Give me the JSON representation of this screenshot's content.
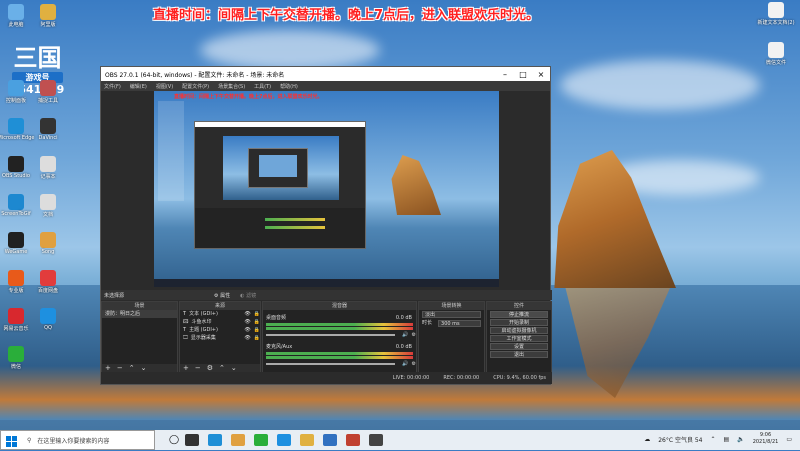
{
  "banner": "直播时间：间隔上下午交替开播。晚上7点后，进入联盟欢乐时光。",
  "logo": {
    "top": "三国",
    "mid": "游戏号",
    "num": "9541939"
  },
  "desktop_left": [
    {
      "label": "此电脑",
      "color": "#6ab0e8"
    },
    {
      "label": "阿里版",
      "color": "#e0b040"
    },
    {
      "label": "控制面板",
      "color": "#4aa0e0"
    },
    {
      "label": "捕捉工具",
      "color": "#c05050"
    },
    {
      "label": "Microsoft Edge",
      "color": "#1f8fd6"
    },
    {
      "label": "DaVinci",
      "color": "#333333"
    },
    {
      "label": "OBS Studio",
      "color": "#222222"
    },
    {
      "label": "记事本",
      "color": "#dddddd"
    },
    {
      "label": "ScreenToGif",
      "color": "#1d88d0"
    },
    {
      "label": "文档",
      "color": "#dddddd"
    },
    {
      "label": "WeGame",
      "color": "#202020"
    },
    {
      "label": "Song",
      "color": "#e0a040"
    },
    {
      "label": "专业版",
      "color": "#e85a1a"
    },
    {
      "label": "百度网盘",
      "color": "#e23c3c"
    },
    {
      "label": "网易云音乐",
      "color": "#d8282e"
    },
    {
      "label": "QQ",
      "color": "#1e90e0"
    },
    {
      "label": "微信",
      "color": "#2aae3a"
    }
  ],
  "desktop_right": [
    {
      "label": "新建文本文档(2)",
      "color": "#f2f2f2"
    },
    {
      "label": "微信文件",
      "color": "#f2f2f2"
    }
  ],
  "obs": {
    "title": "OBS 27.0.1 (64-bit, windows) - 配置文件: 未命名 - 场景: 未命名",
    "menu": [
      "文件(F)",
      "编辑(E)",
      "视图(V)",
      "配置文件(P)",
      "场景集合(S)",
      "工具(T)",
      "帮助(H)"
    ],
    "preview_banner": "直播时间：间隔上下午交替开播。晚上7点后，进入联盟欢乐时光。",
    "scene_label": "未选择源",
    "props_btn": "属性",
    "filters_btn": "滤镜",
    "panels": {
      "scenes": {
        "title": "场景",
        "items": [
          "漫防：明日之后"
        ]
      },
      "sources": {
        "title": "来源",
        "items": [
          "文本 (GDI+)",
          "斗鱼水印",
          "主题 (GDI+)",
          "显示器采集"
        ]
      },
      "mixer": {
        "title": "混音器",
        "channels": [
          {
            "name": "桌面音频",
            "db": "0.0 dB"
          },
          {
            "name": "麦克风/Aux",
            "db": "0.0 dB"
          }
        ]
      },
      "transitions": {
        "title": "场景转换",
        "type": "淡出",
        "duration_label": "时长",
        "duration": "300 ms"
      },
      "controls": {
        "title": "控件",
        "buttons": [
          "停止推流",
          "开始录制",
          "启动虚拟摄像机",
          "工作室模式",
          "设置",
          "退出"
        ]
      }
    },
    "status": {
      "live": "LIVE: 00:00:00",
      "rec": "REC: 00:00:00",
      "cpu": "CPU: 9.4%, 60.00 fps"
    }
  },
  "taskbar": {
    "search_placeholder": "在这里输入你要搜索的内容",
    "weather": "26°C 空气良 54",
    "time": "9:06",
    "date": "2021/8/21",
    "app_colors": [
      "#333333",
      "#1f8fd6",
      "#e0a040",
      "#2aae3a",
      "#1e90e0",
      "#e0b040",
      "#3070c0",
      "#c04030",
      "#444444"
    ]
  }
}
